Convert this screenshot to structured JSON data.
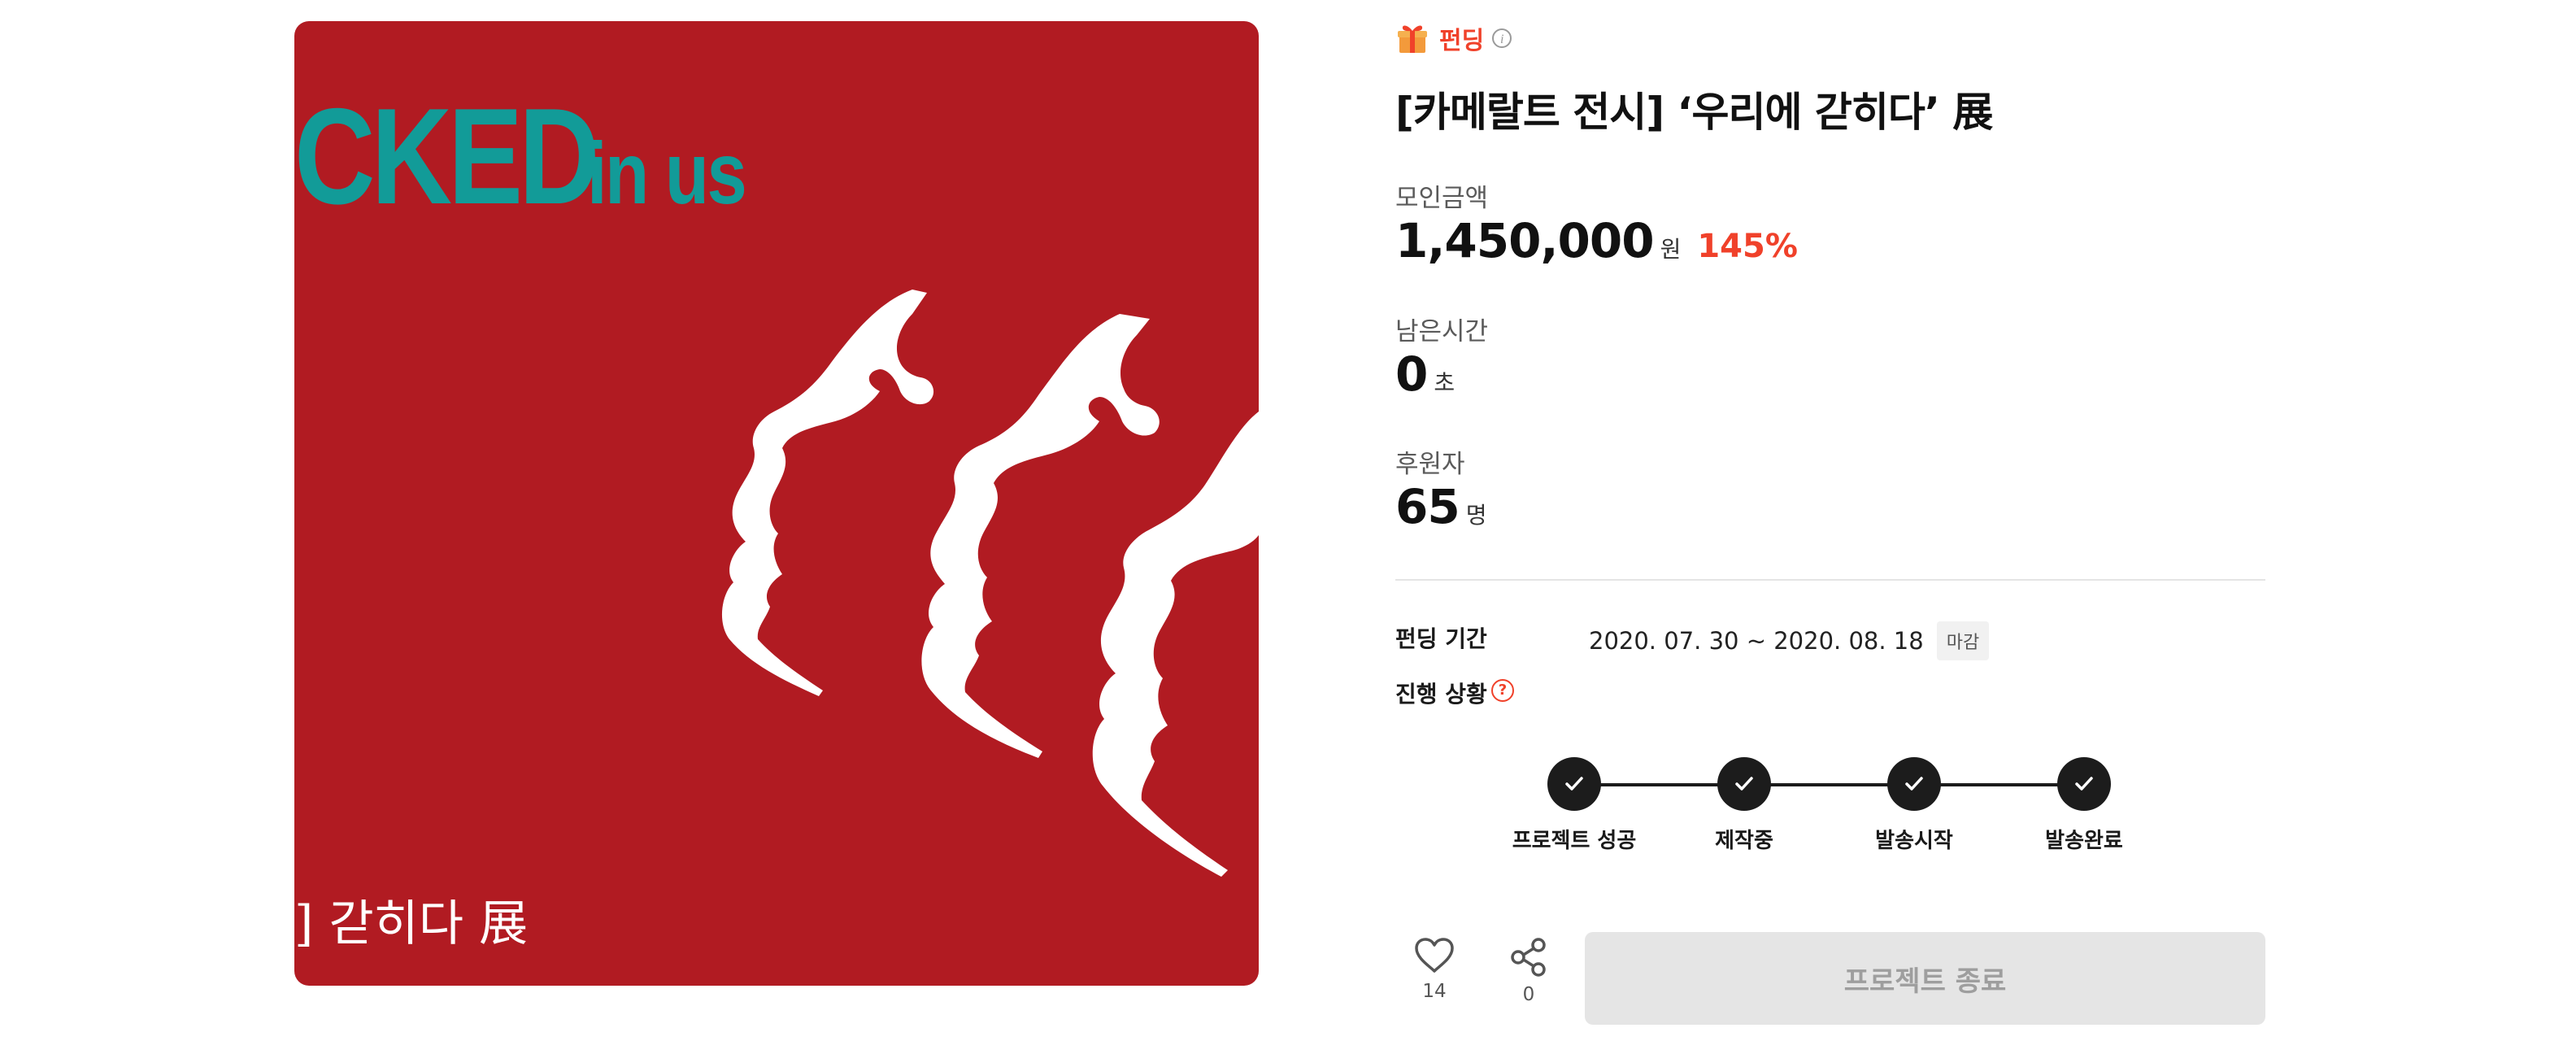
{
  "artwork": {
    "title_big": "CKED",
    "title_small": "in us",
    "caption": "] 갇히다 展"
  },
  "project": {
    "badge": "펀딩",
    "title": "[카메랄트 전시] ‘우리에 갇히다’ 展"
  },
  "stats": {
    "amount_label": "모인금액",
    "amount_value": "1,450,000",
    "amount_unit": "원",
    "amount_percent": "145%",
    "time_label": "남은시간",
    "time_value": "0",
    "time_unit": "초",
    "backers_label": "후원자",
    "backers_value": "65",
    "backers_unit": "명"
  },
  "meta": {
    "period_label": "펀딩 기간",
    "period_value": "2020. 07. 30 ~ 2020. 08. 18",
    "closed_tag": "마감",
    "status_label": "진행 상황",
    "help_glyph": "?"
  },
  "steps": [
    {
      "label": "프로젝트 성공",
      "done": true
    },
    {
      "label": "제작중",
      "done": true
    },
    {
      "label": "발송시작",
      "done": true
    },
    {
      "label": "발송완료",
      "done": true
    }
  ],
  "actions": {
    "like_count": "14",
    "share_count": "0",
    "end_button": "프로젝트 종료"
  },
  "colors": {
    "accent": "#f0412a",
    "artwork_bg": "#b11b22",
    "artwork_title": "#129b98",
    "step_dark": "#1c1c1c"
  },
  "icons": [
    "gift-icon",
    "info-icon",
    "help-icon",
    "check-icon",
    "heart-icon",
    "share-icon"
  ]
}
